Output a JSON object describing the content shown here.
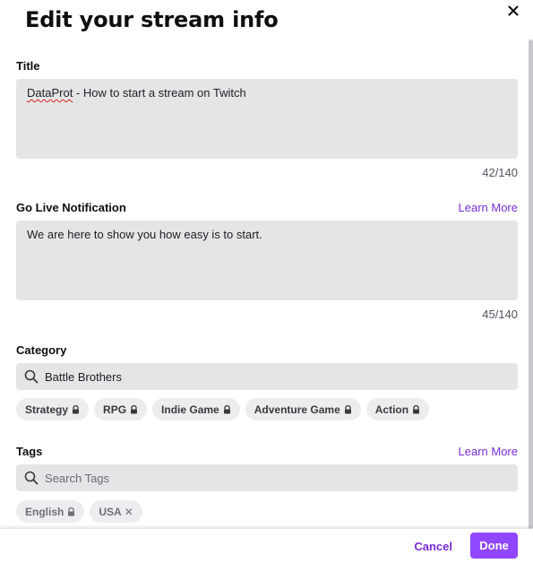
{
  "modal": {
    "title": "Edit your stream info"
  },
  "title_field": {
    "label": "Title",
    "value_misspelled": "DataProt",
    "value_rest": " - How to start a stream on Twitch",
    "counter": "42/140"
  },
  "notification_field": {
    "label": "Go Live Notification",
    "learn_more": "Learn More",
    "value": "We are here to show you how easy is to start.",
    "counter": "45/140"
  },
  "category": {
    "label": "Category",
    "value": "Battle Brothers",
    "chips": [
      {
        "label": "Strategy"
      },
      {
        "label": "RPG"
      },
      {
        "label": "Indie Game"
      },
      {
        "label": "Adventure Game"
      },
      {
        "label": "Action"
      }
    ]
  },
  "tags": {
    "label": "Tags",
    "learn_more": "Learn More",
    "placeholder": "Search Tags",
    "chips": [
      {
        "label": "English"
      },
      {
        "label": "USA"
      }
    ]
  },
  "footer": {
    "cancel": "Cancel",
    "done": "Done"
  },
  "colors": {
    "accent": "#9147ff",
    "link": "#7a2dd8",
    "field_bg": "#e5e5e7"
  }
}
